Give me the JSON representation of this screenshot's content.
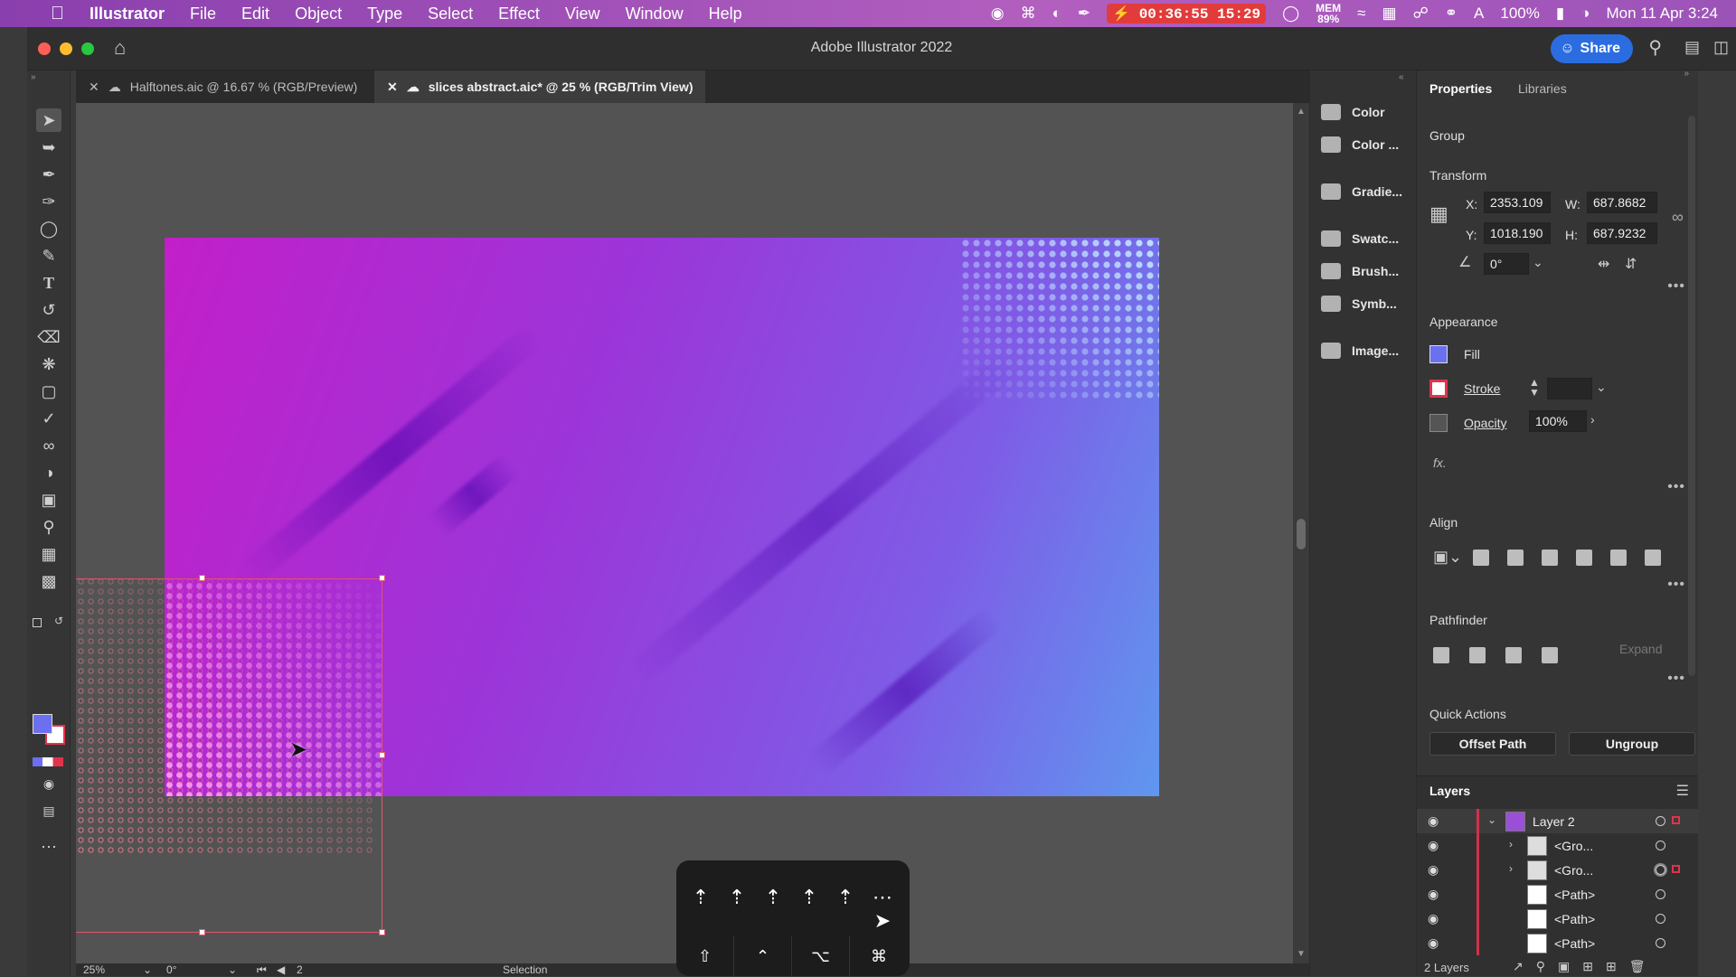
{
  "menubar": {
    "app_name": "Illustrator",
    "items": [
      "File",
      "Edit",
      "Object",
      "Type",
      "Select",
      "Effect",
      "View",
      "Window",
      "Help"
    ],
    "timer": "00:36:55",
    "timer_total": "15:29",
    "mem_label": "MEM",
    "mem_value": "89%",
    "battery": "100%",
    "datetime": "Mon 11 Apr  3:24"
  },
  "window": {
    "title": "Adobe Illustrator 2022",
    "share_label": "Share"
  },
  "tabs": [
    {
      "label": "Halftones.aic @ 16.67 % (RGB/Preview)",
      "active": false
    },
    {
      "label": "slices abstract.aic* @ 25 % (RGB/Trim View)",
      "active": true
    }
  ],
  "status": {
    "zoom": "25%",
    "rotation": "0°",
    "artboard": "2",
    "tool": "Selection"
  },
  "panel_dock": {
    "items": [
      "Color",
      "Color ...",
      "Gradie...",
      "Swatc...",
      "Brush...",
      "Symb...",
      "Image..."
    ]
  },
  "properties": {
    "tab_properties": "Properties",
    "tab_libraries": "Libraries",
    "selection_type": "Group",
    "transform": {
      "title": "Transform",
      "x_label": "X:",
      "x": "2353.109",
      "y_label": "Y:",
      "y": "1018.190",
      "w_label": "W:",
      "w": "687.8682",
      "h_label": "H:",
      "h": "687.9232",
      "angle": "0°"
    },
    "appearance": {
      "title": "Appearance",
      "fill_label": "Fill",
      "stroke_label": "Stroke",
      "opacity_label": "Opacity",
      "opacity": "100%",
      "fx": "fx."
    },
    "align": {
      "title": "Align"
    },
    "pathfinder": {
      "title": "Pathfinder",
      "expand_label": "Expand"
    },
    "quick_actions": {
      "title": "Quick Actions",
      "offset_path": "Offset Path",
      "ungroup": "Ungroup"
    }
  },
  "layers": {
    "title": "Layers",
    "rows": [
      {
        "name": "Layer 2"
      },
      {
        "name": "<Gro..."
      },
      {
        "name": "<Gro..."
      },
      {
        "name": "<Path>"
      },
      {
        "name": "<Path>"
      },
      {
        "name": "<Path>"
      }
    ],
    "count": "2 Layers"
  },
  "colors": {
    "accent": "#2b6de0",
    "selection": "#e0344c",
    "fill_swatch": "#6b6ff0",
    "menubar": "#a24fbb"
  }
}
